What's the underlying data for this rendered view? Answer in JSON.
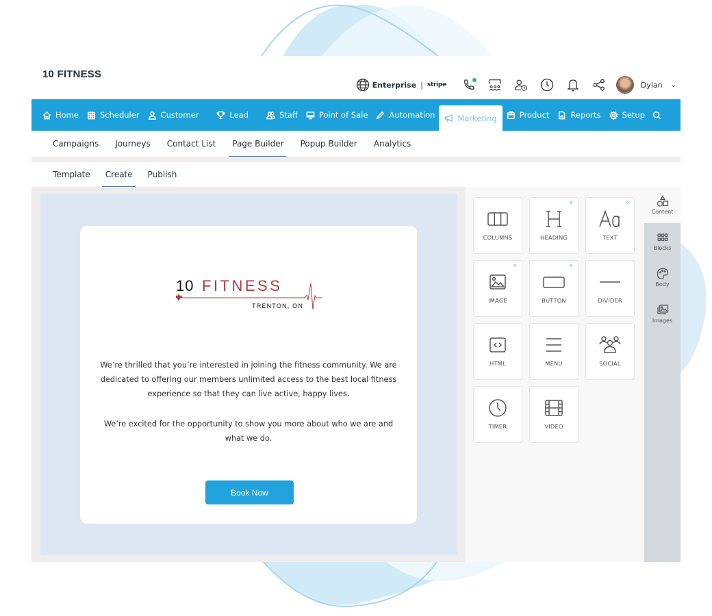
{
  "header": {
    "brand": "10 FITNESS",
    "plan_label": "Enterprise",
    "payment_partner": "stripe",
    "user_name": "Dylan"
  },
  "main_nav": [
    {
      "label": "Home",
      "icon": "home-icon"
    },
    {
      "label": "Scheduler",
      "icon": "calendar-icon"
    },
    {
      "label": "Customer",
      "icon": "user-icon"
    },
    {
      "label": "Lead",
      "icon": "trophy-icon"
    },
    {
      "label": "Staff",
      "icon": "users-icon"
    },
    {
      "label": "Point of Sale",
      "icon": "monitor-icon"
    },
    {
      "label": "Automation",
      "icon": "pen-icon"
    },
    {
      "label": "Marketing",
      "icon": "megaphone-icon",
      "active": true
    },
    {
      "label": "Product",
      "icon": "box-icon"
    },
    {
      "label": "Reports",
      "icon": "report-icon"
    },
    {
      "label": "Setup",
      "icon": "gear-icon"
    }
  ],
  "sub_nav": [
    {
      "label": "Campaigns"
    },
    {
      "label": "Journeys"
    },
    {
      "label": "Contact List"
    },
    {
      "label": "Page Builder",
      "active": true
    },
    {
      "label": "Popup Builder"
    },
    {
      "label": "Analytics"
    }
  ],
  "builder_tabs": [
    {
      "label": "Template"
    },
    {
      "label": "Create",
      "active": true
    },
    {
      "label": "Publish"
    }
  ],
  "email": {
    "logo": {
      "number": "10",
      "word": "FITNESS",
      "location": "TRENTON, ON"
    },
    "paragraph1": "We’re thrilled that you’re interested in joining the fitness community. We are dedicated to offering our members unlimited access to the best local fitness experience so that they can live active, happy lives.",
    "paragraph2": "We’re excited for the opportunity to show you more about who we are and what we do.",
    "cta_label": "Book Now"
  },
  "content_tiles": [
    {
      "label": "COLUMNS",
      "icon": "columns-icon",
      "ai": false
    },
    {
      "label": "HEADING",
      "icon": "heading-icon",
      "ai": true
    },
    {
      "label": "TEXT",
      "icon": "text-icon",
      "ai": true
    },
    {
      "label": "IMAGE",
      "icon": "image-icon",
      "ai": true
    },
    {
      "label": "BUTTON",
      "icon": "button-icon",
      "ai": true
    },
    {
      "label": "DIVIDER",
      "icon": "divider-icon",
      "ai": false
    },
    {
      "label": "HTML",
      "icon": "html-icon",
      "ai": false
    },
    {
      "label": "MENU",
      "icon": "menu-icon",
      "ai": false
    },
    {
      "label": "SOCIAL",
      "icon": "social-icon",
      "ai": false
    },
    {
      "label": "TIMER",
      "icon": "timer-icon",
      "ai": false
    },
    {
      "label": "VIDEO",
      "icon": "video-icon",
      "ai": false
    }
  ],
  "side_tabs": [
    {
      "label": "Content",
      "active": true
    },
    {
      "label": "Blocks"
    },
    {
      "label": "Body"
    },
    {
      "label": "Images"
    }
  ],
  "colors": {
    "nav_blue": "#1ea1db",
    "cta_blue": "#21a2dc",
    "canvas_bg": "#dce7f3",
    "logo_red": "#b03a3a",
    "ai_green": "#2bb98a"
  }
}
